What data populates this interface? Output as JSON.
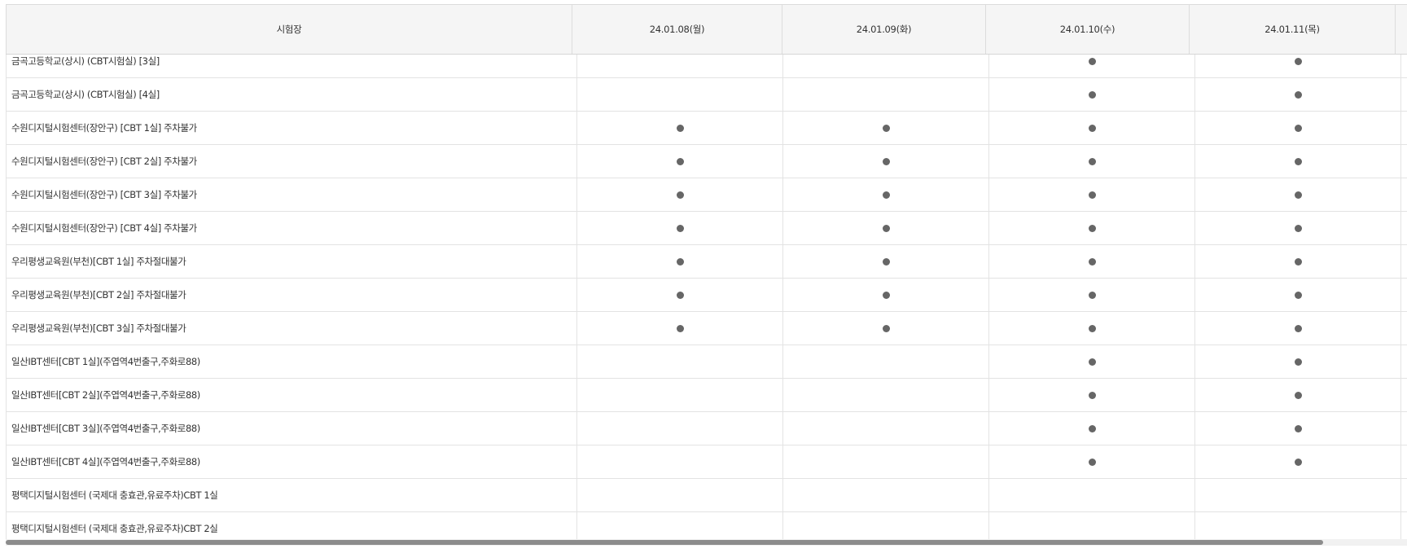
{
  "table": {
    "headers": [
      "시험장",
      "24.01.08(월)",
      "24.01.09(화)",
      "24.01.10(수)",
      "24.01.11(목)"
    ],
    "rows": [
      {
        "name": "금곡고등학교(상시) (CBT시험실) [3실]",
        "slots": [
          false,
          false,
          true,
          true
        ]
      },
      {
        "name": "금곡고등학교(상시) (CBT시험실) [4실]",
        "slots": [
          false,
          false,
          true,
          true
        ]
      },
      {
        "name": "수원디지털시험센터(장안구) [CBT 1실] 주차불가",
        "slots": [
          true,
          true,
          true,
          true
        ]
      },
      {
        "name": "수원디지털시험센터(장안구) [CBT 2실] 주차불가",
        "slots": [
          true,
          true,
          true,
          true
        ]
      },
      {
        "name": "수원디지털시험센터(장안구) [CBT 3실] 주차불가",
        "slots": [
          true,
          true,
          true,
          true
        ]
      },
      {
        "name": "수원디지털시험센터(장안구) [CBT 4실] 주차불가",
        "slots": [
          true,
          true,
          true,
          true
        ]
      },
      {
        "name": "우리평생교육원(부천)[CBT 1실] 주차절대불가",
        "slots": [
          true,
          true,
          true,
          true
        ]
      },
      {
        "name": "우리평생교육원(부천)[CBT 2실] 주차절대불가",
        "slots": [
          true,
          true,
          true,
          true
        ]
      },
      {
        "name": "우리평생교육원(부천)[CBT 3실] 주차절대불가",
        "slots": [
          true,
          true,
          true,
          true
        ]
      },
      {
        "name": "일산IBT센터[CBT 1실](주엽역4번출구,주화로88)",
        "slots": [
          false,
          false,
          true,
          true
        ]
      },
      {
        "name": "일산IBT센터[CBT 2실](주엽역4번출구,주화로88)",
        "slots": [
          false,
          false,
          true,
          true
        ]
      },
      {
        "name": "일산IBT센터[CBT 3실](주엽역4번출구,주화로88)",
        "slots": [
          false,
          false,
          true,
          true
        ]
      },
      {
        "name": "일산IBT센터[CBT 4실](주엽역4번출구,주화로88)",
        "slots": [
          false,
          false,
          true,
          true
        ]
      },
      {
        "name": "평택디지털시험센터 (국제대 충효관,유료주차)CBT 1실",
        "slots": [
          false,
          false,
          false,
          false
        ]
      },
      {
        "name": "평택디지털시험센터 (국제대 충효관,유료주차)CBT 2실",
        "slots": [
          false,
          false,
          false,
          false
        ]
      }
    ]
  },
  "scrollbar": {
    "thumb_fraction": 0.94
  },
  "colors": {
    "dot": "#666666",
    "header_bg": "#f5f5f5",
    "border": "#e3e3e3"
  }
}
